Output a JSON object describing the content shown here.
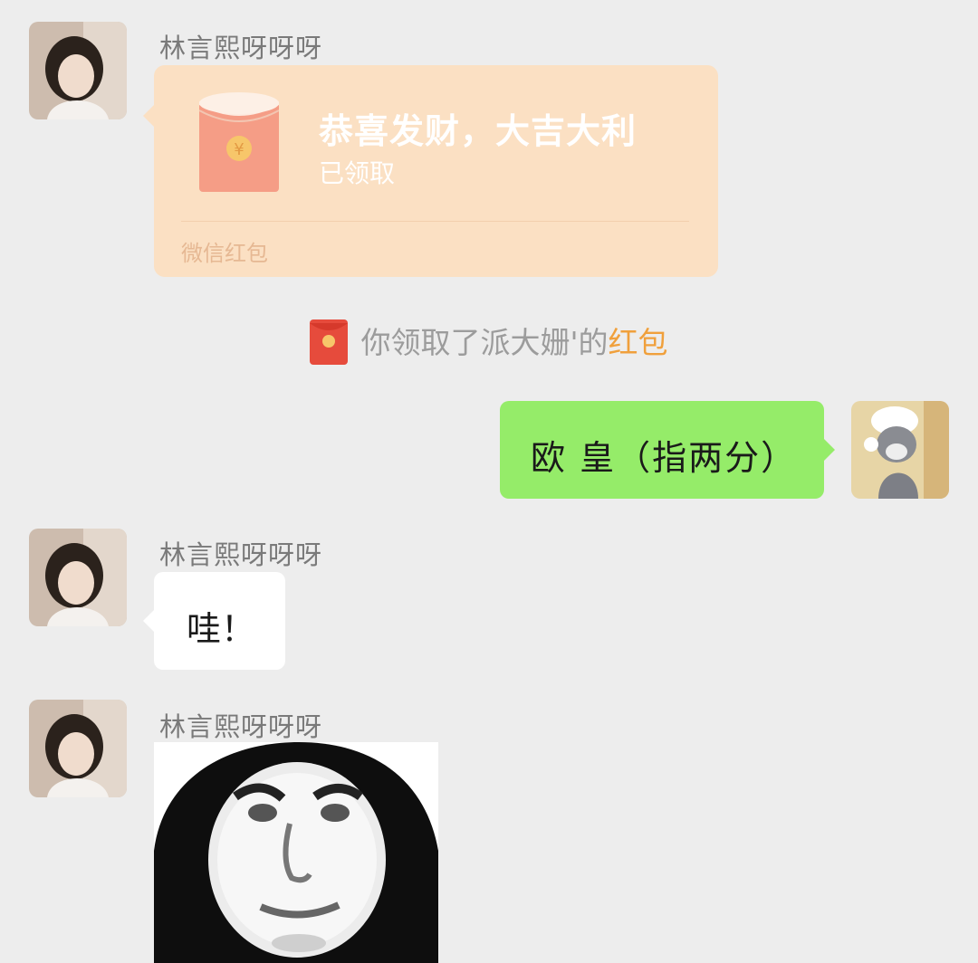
{
  "messages": {
    "m1": {
      "sender": "林言熙呀呀呀",
      "red_packet": {
        "title": "恭喜发财，大吉大利",
        "status": "已领取",
        "footer": "微信红包"
      }
    },
    "notice": {
      "text": "你领取了派大姗'的",
      "highlight": "红包"
    },
    "m2": {
      "text": "欧 皇（指两分）"
    },
    "m3": {
      "sender": "林言熙呀呀呀",
      "text": "哇！"
    },
    "m4": {
      "sender": "林言熙呀呀呀",
      "sticker": "meme-face-sticker"
    }
  },
  "colors": {
    "background": "#ededed",
    "red_packet_card": "#fbe0c3",
    "outgoing_bubble": "#95ec69",
    "incoming_bubble": "#ffffff",
    "highlight": "#f0a03c"
  }
}
